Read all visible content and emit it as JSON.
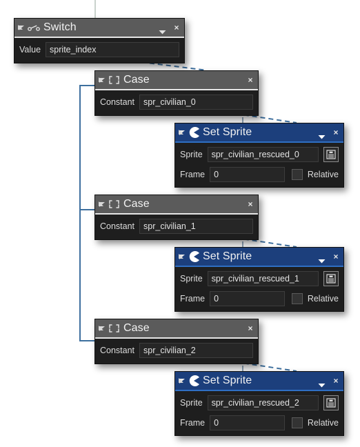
{
  "app": {
    "type": "visual-script-graph",
    "colors": {
      "canvas_bg": "#ffffff",
      "node_bg": "#1e1e1e",
      "header_gray": "#5b5b5b",
      "header_blue": "#1c3f7c",
      "wire": "#3d6f9e",
      "field_bg": "#262626",
      "text": "#e8e8e8"
    }
  },
  "nodes": [
    {
      "id": "switch",
      "title": "Switch",
      "icon": "switch-icon",
      "header_style": "gray",
      "has_caret": true,
      "close_label": "×",
      "fields": [
        {
          "label": "Value",
          "value": "sprite_index",
          "type": "text"
        }
      ]
    },
    {
      "id": "case-0",
      "title": "Case",
      "icon": "case-icon",
      "header_style": "gray",
      "has_caret": false,
      "close_label": "×",
      "fields": [
        {
          "label": "Constant",
          "value": "spr_civilian_0",
          "type": "text"
        }
      ]
    },
    {
      "id": "sprite-0",
      "title": "Set Sprite",
      "icon": "sprite-icon",
      "header_style": "blue",
      "has_caret": true,
      "close_label": "×",
      "fields": [
        {
          "label": "Sprite",
          "value": "spr_civilian_rescued_0",
          "type": "text",
          "menu_button": "sprite-picker-icon"
        },
        {
          "label": "Frame",
          "value": "0",
          "type": "text",
          "checkbox_label": "Relative",
          "checked": false
        }
      ]
    },
    {
      "id": "case-1",
      "title": "Case",
      "icon": "case-icon",
      "header_style": "gray",
      "has_caret": false,
      "close_label": "×",
      "fields": [
        {
          "label": "Constant",
          "value": "spr_civilian_1",
          "type": "text"
        }
      ]
    },
    {
      "id": "sprite-1",
      "title": "Set Sprite",
      "icon": "sprite-icon",
      "header_style": "blue",
      "has_caret": true,
      "close_label": "×",
      "fields": [
        {
          "label": "Sprite",
          "value": "spr_civilian_rescued_1",
          "type": "text",
          "menu_button": "sprite-picker-icon"
        },
        {
          "label": "Frame",
          "value": "0",
          "type": "text",
          "checkbox_label": "Relative",
          "checked": false
        }
      ]
    },
    {
      "id": "case-2",
      "title": "Case",
      "icon": "case-icon",
      "header_style": "gray",
      "has_caret": false,
      "close_label": "×",
      "fields": [
        {
          "label": "Constant",
          "value": "spr_civilian_2",
          "type": "text"
        }
      ]
    },
    {
      "id": "sprite-2",
      "title": "Set Sprite",
      "icon": "sprite-icon",
      "header_style": "blue",
      "has_caret": true,
      "close_label": "×",
      "fields": [
        {
          "label": "Sprite",
          "value": "spr_civilian_rescued_2",
          "type": "text",
          "menu_button": "sprite-picker-icon"
        },
        {
          "label": "Frame",
          "value": "0",
          "type": "text",
          "checkbox_label": "Relative",
          "checked": false
        }
      ]
    }
  ]
}
